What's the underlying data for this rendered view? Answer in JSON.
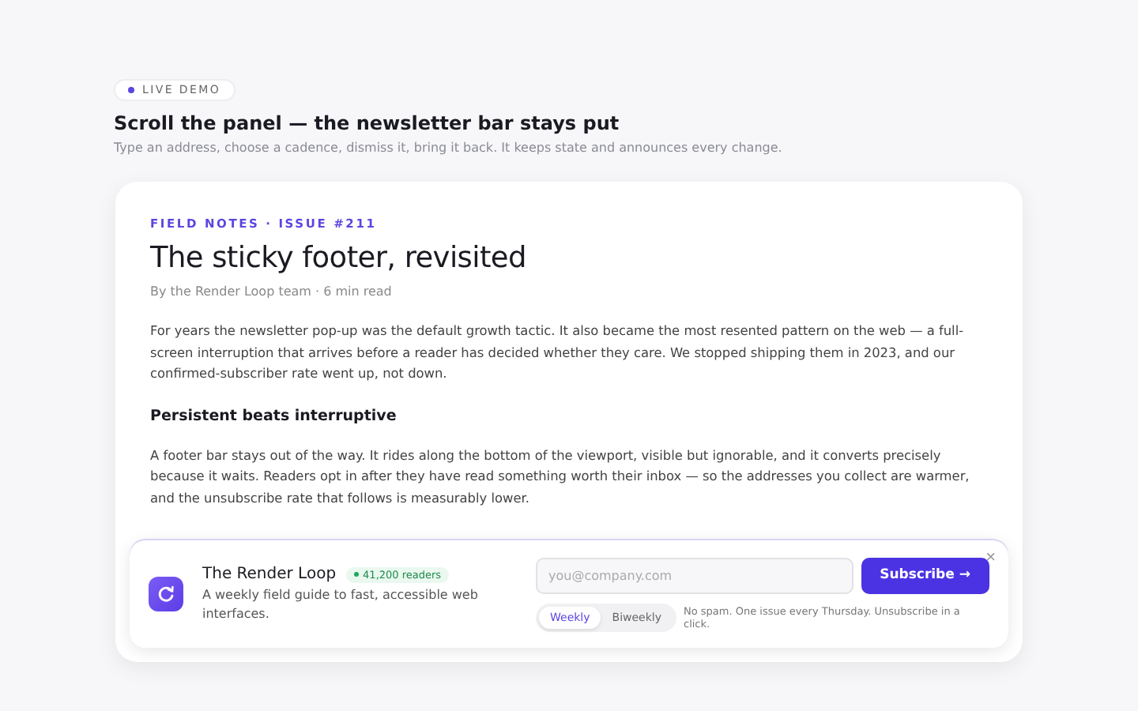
{
  "badge": "LIVE DEMO",
  "heading": "Scroll the panel — the newsletter bar stays put",
  "subheading": "Type an address, choose a cadence, dismiss it, bring it back. It keeps state and announces every change.",
  "article": {
    "eyebrow": "FIELD NOTES · ISSUE #211",
    "title": "The sticky footer, revisited",
    "byline": "By the Render Loop team · 6 min read",
    "blocks": [
      {
        "kind": "paragraph",
        "text": "For years the newsletter pop-up was the default growth tactic. It also became the most resented pattern on the web — a full-screen interruption that arrives before a reader has decided whether they care. We stopped shipping them in 2023, and our confirmed-subscriber rate went up, not down."
      },
      {
        "kind": "heading",
        "text": "Persistent beats interruptive"
      },
      {
        "kind": "paragraph",
        "text": "A footer bar stays out of the way. It rides along the bottom of the viewport, visible but ignorable, and it converts precisely because it waits. Readers opt in after they have read something worth their inbox — so the addresses you collect are warmer, and the unsubscribe rate that follows is measurably lower."
      }
    ]
  },
  "footer": {
    "name": "The Render Loop",
    "readers": "41,200 readers",
    "tagline": "A weekly field guide to fast, accessible web interfaces.",
    "email": {
      "placeholder": "you@company.com"
    },
    "subscribe": "Subscribe →",
    "cadences": [
      {
        "label": "Weekly",
        "selected": true
      },
      {
        "label": "Biweekly",
        "selected": false
      }
    ],
    "note": "No spam. One issue every Thursday. Unsubscribe in a click.",
    "close": "×"
  }
}
